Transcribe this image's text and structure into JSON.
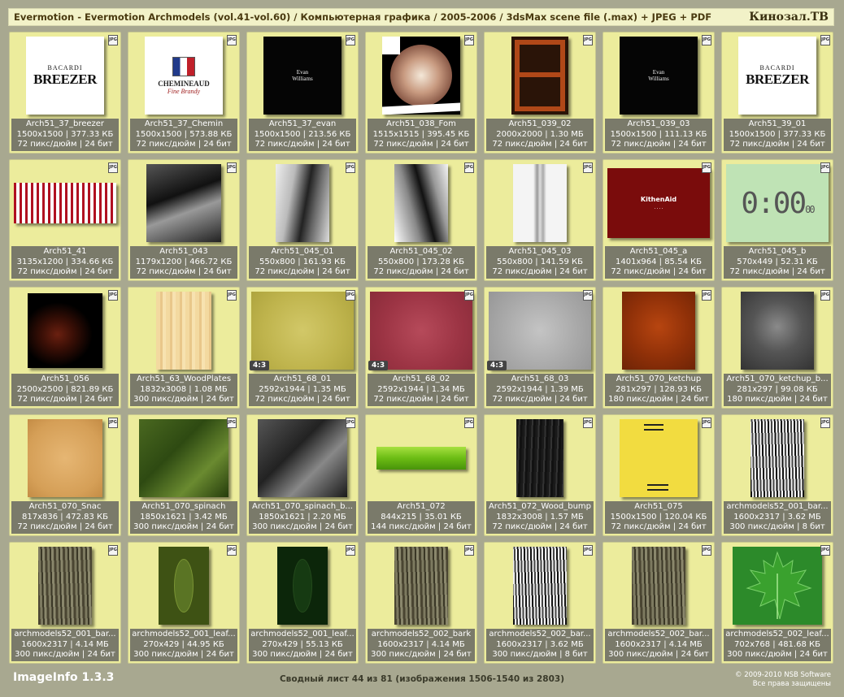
{
  "header": {
    "title": "Evermotion - Evermotion Archmodels (vol.41-vol.60) / Компьютерная графика / 2005-2006 / 3dsMax scene file (.max) + JPEG + PDF",
    "site": "Кинозал.ТВ"
  },
  "file_icon": "JPG",
  "tiles": [
    {
      "name": "Arch51_37_breezer",
      "dims": "1500x1500 | 377.33 КБ",
      "meta": "72 пикс/дюйм | 24 бит",
      "img": "breezer"
    },
    {
      "name": "Arch51_37_Chemin",
      "dims": "1500x1500 | 573.88 КБ",
      "meta": "72 пикс/дюйм | 24 бит",
      "img": "chemin"
    },
    {
      "name": "Arch51_37_evan",
      "dims": "1500x1500 | 213.56 КБ",
      "meta": "72 пикс/дюйм | 24 бит",
      "img": "evan"
    },
    {
      "name": "Arch51_038_Fom",
      "dims": "1515x1515 | 395.45 КБ",
      "meta": "72 пикс/дюйм | 24 бит",
      "img": "fom"
    },
    {
      "name": "Arch51_039_02",
      "dims": "2000x2000 | 1.30 МБ",
      "meta": "72 пикс/дюйм | 24 бит",
      "img": "crate"
    },
    {
      "name": "Arch51_039_03",
      "dims": "1500x1500 | 111.13 КБ",
      "meta": "72 пикс/дюйм | 24 бит",
      "img": "evan"
    },
    {
      "name": "Arch51_39_01",
      "dims": "1500x1500 | 377.33 КБ",
      "meta": "72 пикс/дюйм | 24 бит",
      "img": "breezer"
    },
    {
      "name": "Arch51_41",
      "dims": "3135x1200 | 334.66 КБ",
      "meta": "72 пикс/дюйм | 24 бит",
      "img": "stripes"
    },
    {
      "name": "Arch51_043",
      "dims": "1179x1200 | 466.72 КБ",
      "meta": "72 пикс/дюйм | 24 бит",
      "img": "interior"
    },
    {
      "name": "Arch51_045_01",
      "dims": "550x800 | 161.93 КБ",
      "meta": "72 пикс/дюйм | 24 бит",
      "img": "tower"
    },
    {
      "name": "Arch51_045_02",
      "dims": "550x800 | 173.28 КБ",
      "meta": "72 пикс/дюйм | 24 бит",
      "img": "tower2"
    },
    {
      "name": "Arch51_045_03",
      "dims": "550x800 | 141.59 КБ",
      "meta": "72 пикс/дюйм | 24 бит",
      "img": "twist"
    },
    {
      "name": "Arch51_045_a",
      "dims": "1401x964 | 85.54 КБ",
      "meta": "72 пикс/дюйм | 24 бит",
      "img": "kitchenaid",
      "caption": "KithenAid"
    },
    {
      "name": "Arch51_045_b",
      "dims": "570x449 | 52.31 КБ",
      "meta": "72 пикс/дюйм | 24 бит",
      "img": "clock",
      "caption": "0:00",
      "caption2": "00"
    },
    {
      "name": "Arch51_056",
      "dims": "2500x2500 | 821.89 КБ",
      "meta": "72 пикс/дюйм | 24 бит",
      "img": "pretzel"
    },
    {
      "name": "Arch51_63_WoodPlates",
      "dims": "1832x3008 | 1.08 МБ",
      "meta": "300 пикс/дюйм | 24 бит",
      "img": "wood"
    },
    {
      "name": "Arch51_68_01",
      "dims": "2592x1944 | 1.35 МБ",
      "meta": "72 пикс/дюйм | 24 бит",
      "img": "yellowtex",
      "ratio": "4:3"
    },
    {
      "name": "Arch51_68_02",
      "dims": "2592x1944 | 1.34 МБ",
      "meta": "72 пикс/дюйм | 24 бит",
      "img": "redtex",
      "ratio": "4:3"
    },
    {
      "name": "Arch51_68_03",
      "dims": "2592x1944 | 1.39 МБ",
      "meta": "72 пикс/дюйм | 24 бит",
      "img": "graytex",
      "ratio": "4:3"
    },
    {
      "name": "Arch51_070_ketchup",
      "dims": "281x297 | 128.93 КБ",
      "meta": "180 пикс/дюйм | 24 бит",
      "img": "ketchup"
    },
    {
      "name": "Arch51_070_ketchup_b...",
      "dims": "281x297 | 99.08 КБ",
      "meta": "180 пикс/дюйм | 24 бит",
      "img": "ketchupb"
    },
    {
      "name": "Arch51_070_Snac",
      "dims": "817x836 | 472.83 КБ",
      "meta": "72 пикс/дюйм | 24 бит",
      "img": "snac"
    },
    {
      "name": "Arch51_070_spinach",
      "dims": "1850x1621 | 3.42 МБ",
      "meta": "300 пикс/дюйм | 24 бит",
      "img": "spinach"
    },
    {
      "name": "Arch51_070_spinach_b...",
      "dims": "1850x1621 | 2.20 МБ",
      "meta": "300 пикс/дюйм | 24 бит",
      "img": "spinachb"
    },
    {
      "name": "Arch51_072",
      "dims": "844x215 | 35.01 КБ",
      "meta": "144 пикс/дюйм | 24 бит",
      "img": "greenbar"
    },
    {
      "name": "Arch51_072_Wood_bump",
      "dims": "1832x3008 | 1.57 МБ",
      "meta": "72 пикс/дюйм | 24 бит",
      "img": "woodbump"
    },
    {
      "name": "Arch51_075",
      "dims": "1500x1500 | 120.04 КБ",
      "meta": "72 пикс/дюйм | 24 бит",
      "img": "yellowbox"
    },
    {
      "name": "archmodels52_001_bar...",
      "dims": "1600x2317 | 3.62 МБ",
      "meta": "300 пикс/дюйм | 8 бит",
      "img": "barkbw"
    },
    {
      "name": "archmodels52_001_bar...",
      "dims": "1600x2317 | 4.14 МБ",
      "meta": "300 пикс/дюйм | 24 бит",
      "img": "bark"
    },
    {
      "name": "archmodels52_001_leaf...",
      "dims": "270x429 | 44.95 КБ",
      "meta": "300 пикс/дюйм | 24 бит",
      "img": "leaf"
    },
    {
      "name": "archmodels52_001_leaf...",
      "dims": "270x429 | 55.13 КБ",
      "meta": "300 пикс/дюйм | 24 бит",
      "img": "leafdark"
    },
    {
      "name": "archmodels52_002_bark",
      "dims": "1600x2317 | 4.14 МБ",
      "meta": "300 пикс/дюйм | 24 бит",
      "img": "bark"
    },
    {
      "name": "archmodels52_002_bar...",
      "dims": "1600x2317 | 3.62 МБ",
      "meta": "300 пикс/дюйм | 8 бит",
      "img": "barkbw"
    },
    {
      "name": "archmodels52_002_bar...",
      "dims": "1600x2317 | 4.14 МБ",
      "meta": "300 пикс/дюйм | 24 бит",
      "img": "bark"
    },
    {
      "name": "archmodels52_002_leaf...",
      "dims": "702x768 | 481.68 КБ",
      "meta": "300 пикс/дюйм | 24 бит",
      "img": "mapleleaf"
    }
  ],
  "thumb_text": {
    "breezer_brand": "BACARDI",
    "breezer_name": "BREEZER",
    "chemin_name": "CHEMINEAUD",
    "chemin_sub": "Fine Brandy",
    "evan_line1": "Evan",
    "evan_line2": "Williams"
  },
  "footer": {
    "app": "ImageInfo 1.3.3",
    "summary": "Сводный лист 44 из 81 (изображения 1506-1540 из 2803)",
    "copyright": "© 2009-2010 NSB Software",
    "rights": "Все права защищены"
  }
}
